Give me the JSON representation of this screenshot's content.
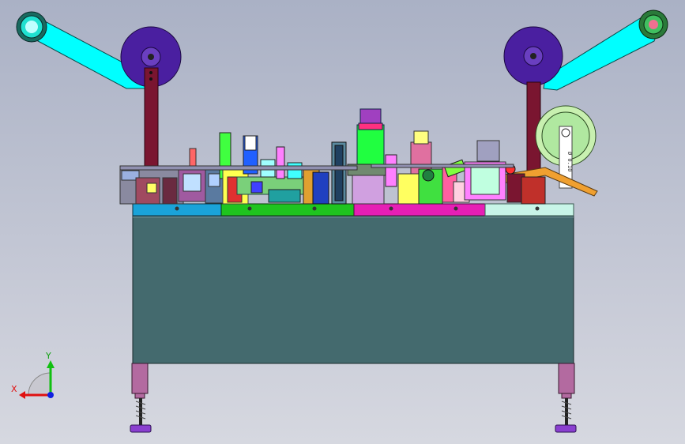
{
  "triad": {
    "x_label": "X",
    "y_label": "Y"
  },
  "reel_marking": "Ø 0.10",
  "colors": {
    "background_top": "#aab1c5",
    "cabinet": "#446a6e",
    "arm": "#00ffff",
    "post": "#7a1530",
    "reel": "#4a1fa0",
    "foot": "#b36aa0",
    "bed_zone_1": "#1aa3d9",
    "bed_zone_2": "#1fc41f",
    "bed_zone_3": "#e61fb5",
    "bed_zone_4": "#c8f5e8",
    "feeder_strip": "#f0a030"
  }
}
